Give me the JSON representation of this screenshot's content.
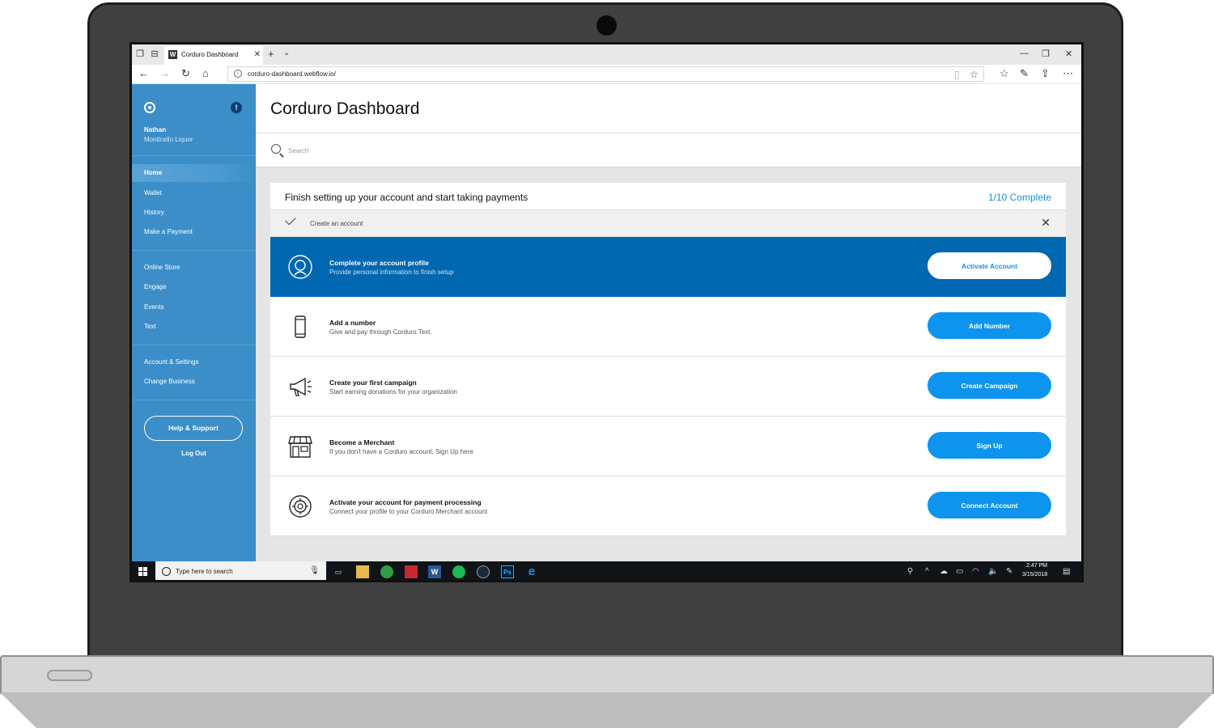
{
  "browser": {
    "tab_title": "Corduro Dashboard",
    "favicon": "W",
    "url": "corduro-dashboard.webflow.io/"
  },
  "sidebar": {
    "user_name": "Nathan",
    "business": "Monticello Liquor",
    "alert_badge": "!",
    "groups": [
      {
        "items": [
          {
            "label": "Home",
            "active": true
          },
          {
            "label": "Wallet"
          },
          {
            "label": "History"
          },
          {
            "label": "Make a Payment"
          }
        ]
      },
      {
        "items": [
          {
            "label": "Online Store"
          },
          {
            "label": "Engage"
          },
          {
            "label": "Events"
          },
          {
            "label": "Text"
          }
        ]
      },
      {
        "items": [
          {
            "label": "Account & Settings"
          },
          {
            "label": "Change Business"
          }
        ]
      }
    ],
    "help_label": "Help & Support",
    "logout_label": "Log Out"
  },
  "main": {
    "title": "Corduro Dashboard",
    "search_placeholder": "Search"
  },
  "setup": {
    "title": "Finish setting up your account and start taking payments",
    "progress": "1/10 Complete",
    "completed_item": "Create an account",
    "tasks": [
      {
        "title": "Complete your account profile",
        "subtitle": "Provide personal information to finish setup",
        "button": "Activate Account",
        "icon": "user-profile-icon",
        "active": true
      },
      {
        "title": "Add a number",
        "subtitle": "Give and pay through Corduro Text.",
        "button": "Add Number",
        "icon": "mobile-phone-icon"
      },
      {
        "title": "Create your first campaign",
        "subtitle": "Start earning donations for your organization",
        "button": "Create Campaign",
        "icon": "megaphone-icon"
      },
      {
        "title": "Become a Merchant",
        "subtitle": "If you don't have a Corduro account, Sign Up here",
        "button": "Sign Up",
        "icon": "storefront-icon"
      },
      {
        "title": "Activate your account for payment processing",
        "subtitle": "Connect your profile to your Corduro Merchant account",
        "button": "Connect Account",
        "icon": "safe-icon"
      }
    ]
  },
  "taskbar": {
    "search_placeholder": "Type here to search",
    "time": "2:47 PM",
    "date": "3/15/2018",
    "ps_label": "Ps"
  },
  "colors": {
    "sidebar": "#3b8ec8",
    "active_task": "#0067b1",
    "button": "#0d94ef",
    "progress_text": "#1a8fd6"
  }
}
